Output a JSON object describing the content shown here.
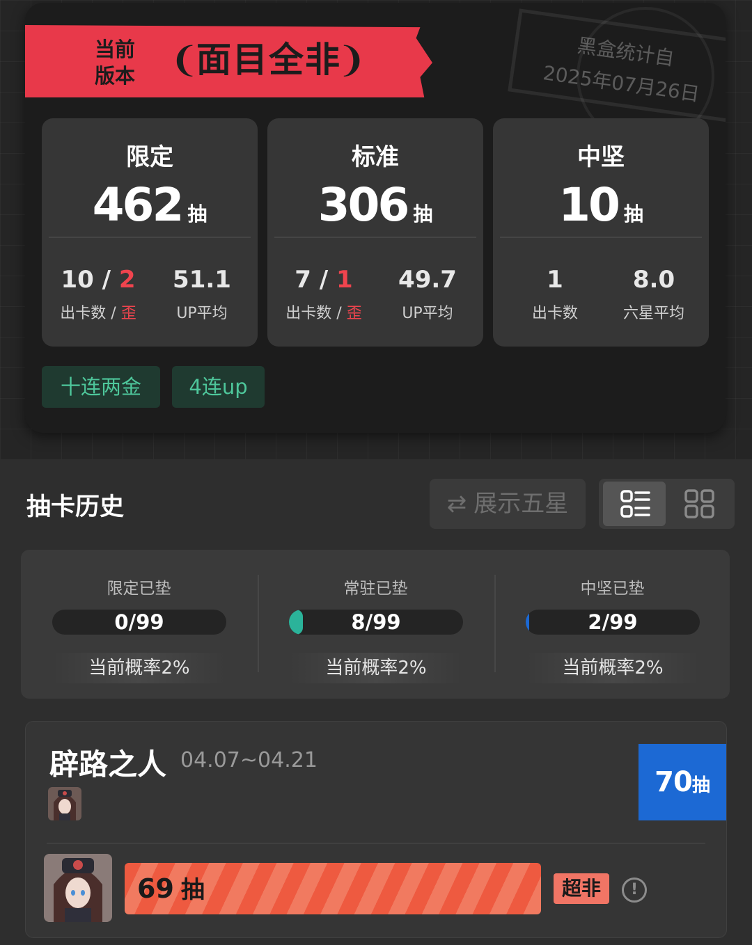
{
  "summary": {
    "ribbon_label": "当前版本",
    "ribbon_laurel_left": "❨",
    "ribbon_laurel_right": "❩",
    "ribbon_title": "面目全非",
    "stamp": {
      "line1": "黑盒统计自",
      "line2": "2025年07月26日"
    },
    "stats": [
      {
        "title": "限定",
        "number": "462",
        "unit": "抽",
        "col1_value": "10",
        "col1_sep": " / ",
        "col1_red": "2",
        "col1_label": "出卡数",
        "col1_label_sep": " / ",
        "col1_label_red": "歪",
        "col2_value": "51.1",
        "col2_label": "UP平均"
      },
      {
        "title": "标准",
        "number": "306",
        "unit": "抽",
        "col1_value": "7",
        "col1_sep": " / ",
        "col1_red": "1",
        "col1_label": "出卡数",
        "col1_label_sep": " / ",
        "col1_label_red": "歪",
        "col2_value": "49.7",
        "col2_label": "UP平均"
      },
      {
        "title": "中坚",
        "number": "10",
        "unit": "抽",
        "col1_value": "1",
        "col1_label": "出卡数",
        "col2_value": "8.0",
        "col2_label": "六星平均"
      }
    ],
    "tags": [
      "十连两金",
      "4连up"
    ]
  },
  "history": {
    "title": "抽卡历史",
    "toggle_five_icon": "swap-icon",
    "toggle_five_symbol": "⇄",
    "toggle_five_label": "展示五星",
    "view_modes": [
      "list-view-icon",
      "grid-view-icon"
    ]
  },
  "pity": [
    {
      "label": "限定已垫",
      "value": "0/99",
      "fraction": 0.0,
      "color": "#2bb39a",
      "rate": "当前概率2%"
    },
    {
      "label": "常驻已垫",
      "value": "8/99",
      "fraction": 0.0808,
      "color": "#2bb39a",
      "rate": "当前概率2%"
    },
    {
      "label": "中坚已垫",
      "value": "2/99",
      "fraction": 0.0202,
      "color": "#1c69d4",
      "rate": "当前概率2%"
    }
  ],
  "banner": {
    "name": "辟路之人",
    "dates": "04.07~04.21",
    "total_pulls": "70",
    "total_unit": "抽",
    "result": {
      "pulls": "69",
      "unit": "抽",
      "fraction": 0.697,
      "badge": "超非",
      "info_symbol": "!"
    }
  },
  "colors": {
    "ribbon": "#e8394a",
    "accent_red": "#f0444e",
    "tag_green": "#4ec79b",
    "badge_blue": "#1c69d4",
    "bar_orange": "#ee5a40"
  }
}
